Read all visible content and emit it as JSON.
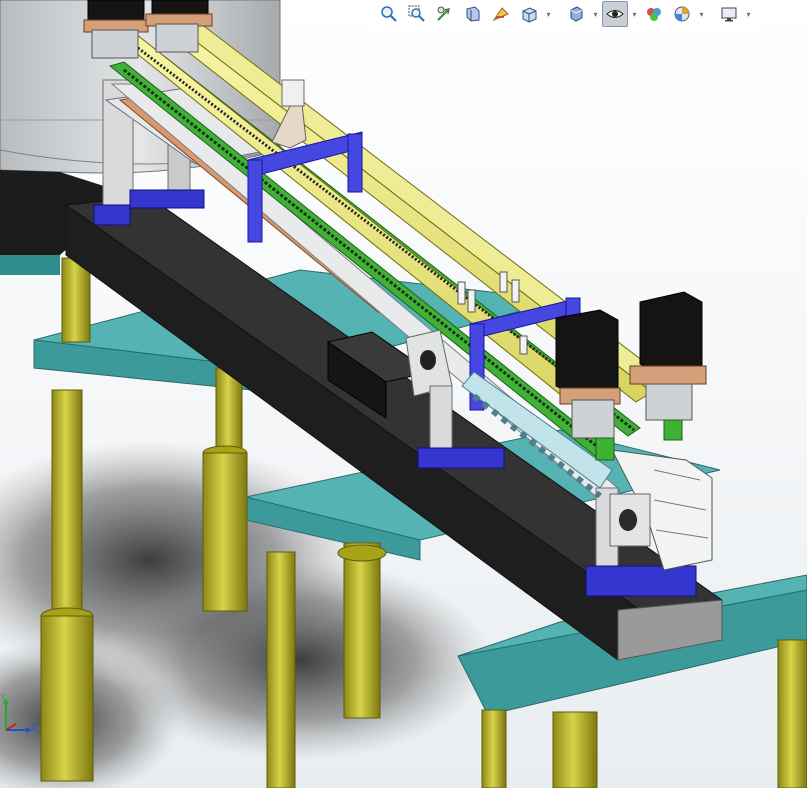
{
  "toolbar": {
    "tools": [
      {
        "id": "zoom-to-fit",
        "icon": "zoom-to-fit-icon",
        "dropdown": false,
        "active": false
      },
      {
        "id": "zoom-to-area",
        "icon": "zoom-to-area-icon",
        "dropdown": false,
        "active": false
      },
      {
        "id": "previous-view",
        "icon": "previous-view-icon",
        "dropdown": false,
        "active": false
      },
      {
        "id": "section-view",
        "icon": "section-view-icon",
        "dropdown": false,
        "active": false
      },
      {
        "id": "dynamic-annotation",
        "icon": "dynamic-annotation-icon",
        "dropdown": false,
        "active": false
      },
      {
        "id": "view-orientation",
        "icon": "view-orientation-icon",
        "dropdown": true,
        "active": false
      },
      {
        "id": "display-style",
        "icon": "display-style-icon",
        "dropdown": true,
        "active": false
      },
      {
        "id": "hide-show-items",
        "icon": "hide-show-items-icon",
        "dropdown": true,
        "active": true
      },
      {
        "id": "edit-appearance",
        "icon": "edit-appearance-icon",
        "dropdown": false,
        "active": false
      },
      {
        "id": "apply-scene",
        "icon": "apply-scene-icon",
        "dropdown": true,
        "active": false
      },
      {
        "id": "view-settings",
        "icon": "view-settings-icon",
        "dropdown": true,
        "active": false
      }
    ]
  },
  "triad": {
    "y_label": "Y",
    "z_label": "Z"
  },
  "colors": {
    "rail_yellow": "#f2ef8a",
    "rail_green": "#3caa32",
    "frame_blue": "#3a3ad8",
    "beam_black": "#262626",
    "platform_teal": "#47a6a6",
    "leg_olive": "#b7b21c",
    "motor_black": "#141414",
    "bracket_silver": "#d6d8da",
    "copper": "#c9865a"
  }
}
